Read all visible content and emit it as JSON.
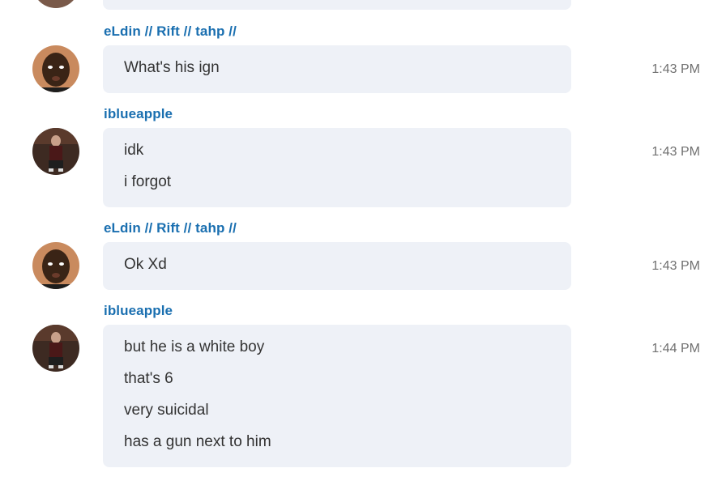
{
  "messages": [
    {
      "sender": "eLdin // Rift // tahp //",
      "avatar": "eldin-avatar",
      "time": "1:43 PM",
      "lines": [
        "What's his ign"
      ]
    },
    {
      "sender": "iblueapple",
      "avatar": "iblueapple-avatar",
      "time": "1:43 PM",
      "lines": [
        "idk",
        "i forgot"
      ]
    },
    {
      "sender": "eLdin // Rift // tahp //",
      "avatar": "eldin-avatar",
      "time": "1:43 PM",
      "lines": [
        "Ok Xd"
      ]
    },
    {
      "sender": "iblueapple",
      "avatar": "iblueapple-avatar",
      "time": "1:44 PM",
      "lines": [
        "but he is a white boy",
        "that's 6",
        "very suicidal",
        "has a gun next to him"
      ]
    }
  ],
  "colors": {
    "sender": "#1a6fb0",
    "bubble": "#eef1f7",
    "text": "#333333",
    "time": "#707070"
  }
}
